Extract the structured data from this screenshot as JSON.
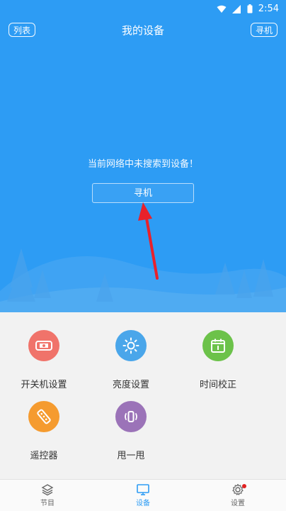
{
  "status_bar": {
    "time": "2:54"
  },
  "header": {
    "left_button": "列表",
    "title": "我的设备",
    "right_button": "寻机"
  },
  "main": {
    "message": "当前网络中未搜索到设备！",
    "search_button": "寻机"
  },
  "functions": [
    {
      "label": "开关机设置",
      "color": "#f0736a",
      "icon": "power-schedule-icon"
    },
    {
      "label": "亮度设置",
      "color": "#4aa6ea",
      "icon": "sun-icon"
    },
    {
      "label": "时间校正",
      "color": "#6cc24a",
      "icon": "calendar-icon"
    },
    {
      "label": "遥控器",
      "color": "#f59b2f",
      "icon": "remote-icon"
    },
    {
      "label": "甩一甩",
      "color": "#9b73b8",
      "icon": "shake-icon"
    }
  ],
  "tabs": [
    {
      "label": "节目",
      "icon": "layers-icon"
    },
    {
      "label": "设备",
      "icon": "monitor-icon",
      "active": true
    },
    {
      "label": "设置",
      "icon": "gear-icon",
      "has_badge": true
    }
  ],
  "colors": {
    "primary": "#2d9cf4",
    "arrow": "#e8212b"
  }
}
